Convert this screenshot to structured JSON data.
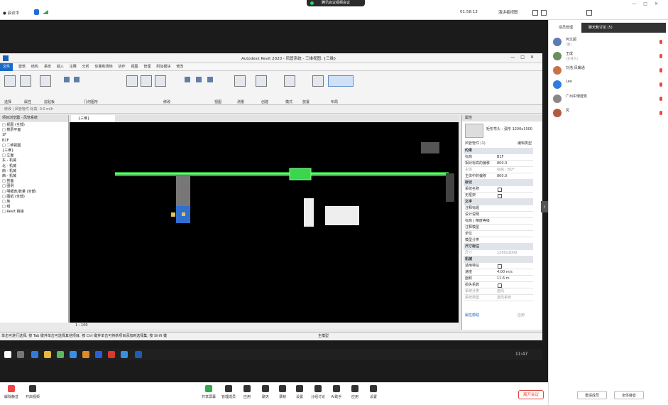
{
  "topbar": {
    "recording_label": "腾讯会议视频会议",
    "meeting_info": "● 会议中",
    "timer": "01:58:13",
    "view_label": "演讲者视图"
  },
  "revit": {
    "title": "Autodesk Revit 2020 - 风管系统 - 三维视图: {三维}",
    "menus": [
      "文件",
      "建筑",
      "结构",
      "系统",
      "插入",
      "注释",
      "分析",
      "体量和场地",
      "协作",
      "视图",
      "管理",
      "附加模块",
      "修改"
    ],
    "panels": [
      "选择",
      "属性",
      "剪贴板",
      "几何图形",
      "修改",
      "视图",
      "测量",
      "创建",
      "模式",
      "放置",
      "布局"
    ],
    "option_bar": "修改 | 风管管件    标高: 0.0 m/h",
    "project_browser_title": "项目浏览器 - 风管系统",
    "tree": [
      "□ 视图 (全部)",
      "  □ 楼层平面",
      "    1F",
      "    B1F",
      "  □ 二维视图",
      "    {三维}",
      "  □ 立面",
      "    东 - 机械",
      "    北 - 机械",
      "    南 - 机械",
      "    西 - 机械",
      "  □ 剖面",
      "□ 图例",
      "□ 明细表/数量 (全部)",
      "□ 图纸 (全部)",
      "□ 族",
      "□ 组",
      "□ Revit 链接"
    ],
    "view_tab": "{三维}",
    "view_scale": "1 : 100",
    "statusbar": "单击可进行选择; 按 Tab 键并单击可选择其他项目; 按 Ctrl 键并单击可将新项目添加到选择集; 按 Shift 键",
    "statusbar_model": "主模型",
    "properties": {
      "title": "属性",
      "type_name": "矩形弯头 - 弧形 1200x1000",
      "selector": "风管管件 (1)",
      "edit_type": "编辑类型",
      "rows": [
        {
          "k": "约束",
          "v": "",
          "grp": true
        },
        {
          "k": "标高",
          "v": "B1F"
        },
        {
          "k": "相对标高的偏移",
          "v": "800.0"
        },
        {
          "k": "主体",
          "v": "标高 : B1F",
          "dim": true
        },
        {
          "k": "主体中的偏移",
          "v": "800.0"
        },
        {
          "k": "标记",
          "v": "",
          "grp": true
        },
        {
          "k": "系统名称",
          "v": "",
          "chk": true
        },
        {
          "k": "无框架",
          "v": "",
          "chk": true
        },
        {
          "k": "文字",
          "v": "",
          "grp": true
        },
        {
          "k": "注释标题",
          "v": ""
        },
        {
          "k": "设计说明",
          "v": ""
        },
        {
          "k": "标高 | 精度等级",
          "v": ""
        },
        {
          "k": "注释模型",
          "v": ""
        },
        {
          "k": "单位",
          "v": ""
        },
        {
          "k": "模型分类",
          "v": ""
        },
        {
          "k": "尺寸标注",
          "v": "",
          "grp": true
        },
        {
          "k": "尺寸",
          "v": "1200x1000",
          "dim": true
        },
        {
          "k": "机械",
          "v": "",
          "grp": true
        },
        {
          "k": "适用特征",
          "v": "",
          "chk": true
        },
        {
          "k": "速度",
          "v": "4.00 m/s"
        },
        {
          "k": "面积",
          "v": "11.6 m"
        },
        {
          "k": "损失系数",
          "v": "",
          "chk": true
        },
        {
          "k": "系统分类",
          "v": "送风",
          "dim": true
        },
        {
          "k": "系统类型",
          "v": "送风系统",
          "dim": true
        }
      ],
      "help_link": "属性帮助",
      "apply": "应用"
    }
  },
  "taskbar": {
    "time": "11:47"
  },
  "right_panel": {
    "tab_members": "成员管理",
    "tab_chat": "聊天和讨论 (5)",
    "members": [
      {
        "name": "何文超",
        "sub": "(我)",
        "color": "#5b7bb5"
      },
      {
        "name": "王成",
        "sub": "(主持人)",
        "color": "#6a8f5a"
      },
      {
        "name": "刘浩-风暖通",
        "sub": "",
        "color": "#c8744a"
      },
      {
        "name": "Leo",
        "sub": "",
        "color": "#2f7be0"
      },
      {
        "name": "广州中博建筑",
        "sub": "",
        "color": "#888"
      },
      {
        "name": "风",
        "sub": "",
        "color": "#b05c3c"
      }
    ],
    "btn_invite": "邀请成员",
    "btn_mute": "全体静音"
  },
  "bottombar": {
    "items": [
      "共享屏幕",
      "管理成员",
      "应用",
      "聊天",
      "录制",
      "设置",
      "分组讨论",
      "AI助手",
      "应用",
      "设置"
    ],
    "unmute": "解除静音",
    "video": "开启视频",
    "end": "离开会议"
  }
}
